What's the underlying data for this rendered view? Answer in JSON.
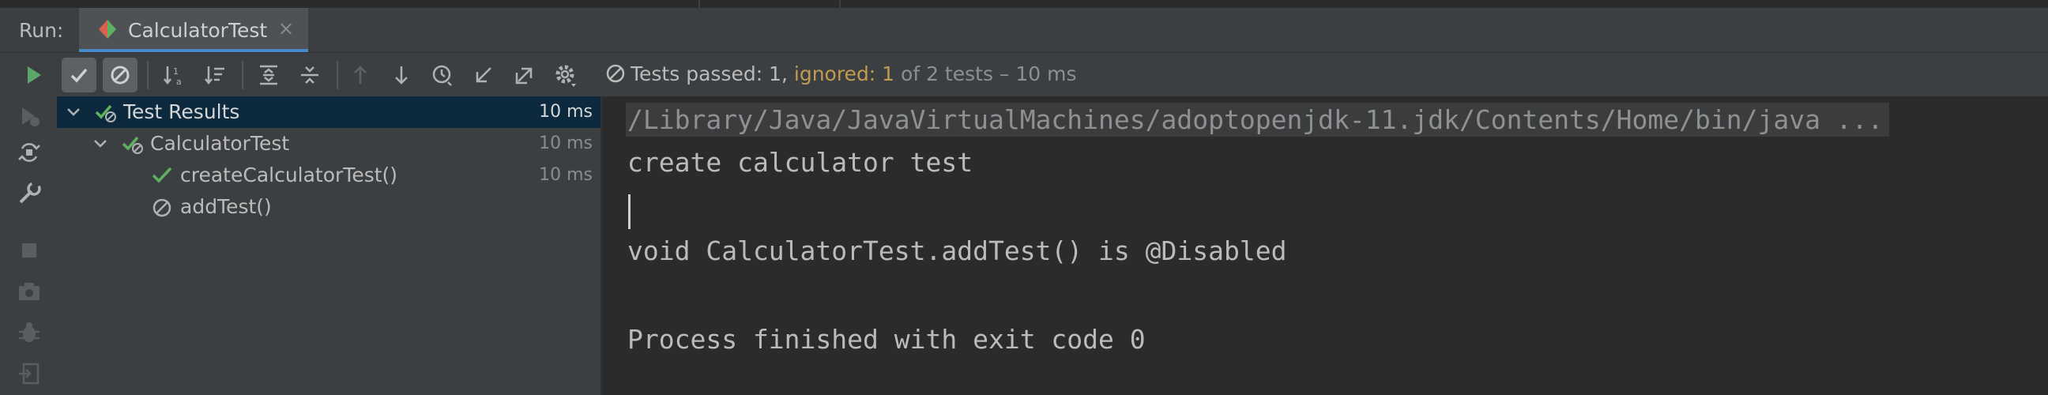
{
  "header": {
    "run_label": "Run:",
    "tab_label": "CalculatorTest",
    "tab_close": "×"
  },
  "toolbar": {
    "icons": [
      "run-icon",
      "show-passed-icon",
      "show-ignored-icon",
      "sort-alpha-icon",
      "sort-duration-icon",
      "expand-all-icon",
      "collapse-all-icon",
      "prev-failed-icon",
      "next-failed-icon",
      "history-icon",
      "import-tests-icon",
      "export-tests-icon",
      "settings-icon"
    ],
    "status": {
      "prefix": "Tests passed: 1, ",
      "ignored": "ignored: 1",
      "suffix": " of 2 tests – 10 ms"
    }
  },
  "leftbar": {
    "icons": [
      "rerun-failed-icon",
      "toggle-auto-test-icon",
      "wrench-icon",
      "stop-icon",
      "camera-icon",
      "debug-icon",
      "exit-icon"
    ]
  },
  "tree": {
    "rows": [
      {
        "label": "Test Results",
        "time": "10 ms",
        "status": "passed"
      },
      {
        "label": "CalculatorTest",
        "time": "10 ms",
        "status": "passed"
      },
      {
        "label": "createCalculatorTest()",
        "time": "10 ms",
        "status": "passed"
      },
      {
        "label": "addTest()",
        "time": "",
        "status": "ignored"
      }
    ]
  },
  "console": {
    "command": "/Library/Java/JavaVirtualMachines/adoptopenjdk-11.jdk/Contents/Home/bin/java ...",
    "line1": "create calculator test",
    "line2": "void CalculatorTest.addTest() is @Disabled",
    "line3": "Process finished with exit code 0"
  },
  "colors": {
    "passed": "#5fb05f",
    "ignored_text": "#c29a52",
    "selection": "#0d293e",
    "accent": "#4a88c7"
  }
}
